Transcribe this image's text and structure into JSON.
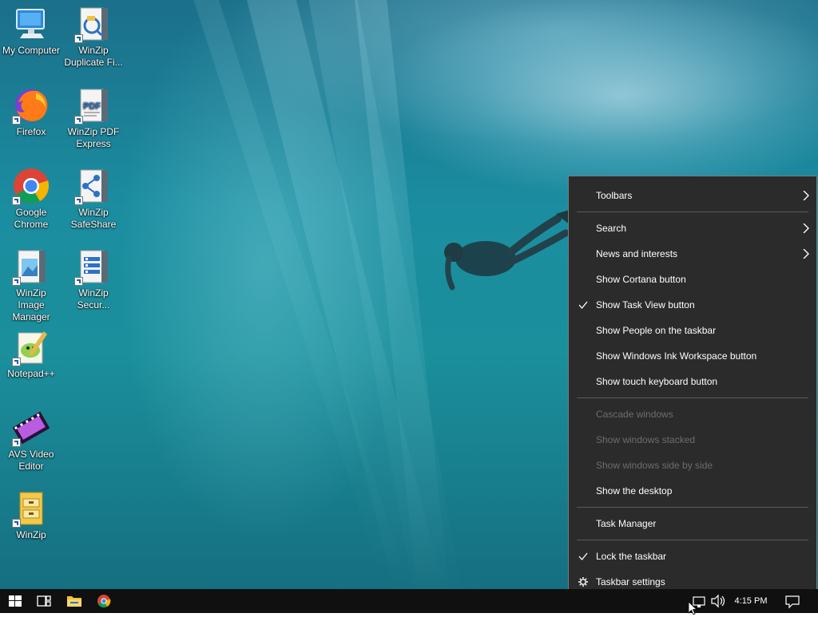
{
  "desktop": {
    "icons": [
      {
        "label": "My Computer",
        "icon": "computer-icon"
      },
      {
        "label": "WinZip Duplicate Fi...",
        "icon": "winzip-duplicate-icon"
      },
      {
        "label": "Firefox",
        "icon": "firefox-icon"
      },
      {
        "label": "WinZip PDF Express",
        "icon": "winzip-pdf-icon"
      },
      {
        "label": "Google Chrome",
        "icon": "chrome-icon"
      },
      {
        "label": "WinZip SafeShare",
        "icon": "winzip-safeshare-icon"
      },
      {
        "label": "WinZip Image Manager",
        "icon": "winzip-image-manager-icon"
      },
      {
        "label": "WinZip Secur...",
        "icon": "winzip-secure-icon"
      },
      {
        "label": "Notepad++",
        "icon": "notepadpp-icon"
      },
      {
        "label": "AVS Video Editor",
        "icon": "avs-video-editor-icon"
      },
      {
        "label": "WinZip",
        "icon": "winzip-icon"
      }
    ]
  },
  "context_menu": {
    "items": [
      {
        "label": "Toolbars",
        "submenu": true,
        "checked": false,
        "disabled": false
      },
      {
        "label": "Search",
        "submenu": true,
        "checked": false,
        "disabled": false
      },
      {
        "label": "News and interests",
        "submenu": true,
        "checked": false,
        "disabled": false
      },
      {
        "label": "Show Cortana button",
        "submenu": false,
        "checked": false,
        "disabled": false
      },
      {
        "label": "Show Task View button",
        "submenu": false,
        "checked": true,
        "disabled": false
      },
      {
        "label": "Show People on the taskbar",
        "submenu": false,
        "checked": false,
        "disabled": false
      },
      {
        "label": "Show Windows Ink Workspace button",
        "submenu": false,
        "checked": false,
        "disabled": false
      },
      {
        "label": "Show touch keyboard button",
        "submenu": false,
        "checked": false,
        "disabled": false
      },
      {
        "label": "Cascade windows",
        "submenu": false,
        "checked": false,
        "disabled": true
      },
      {
        "label": "Show windows stacked",
        "submenu": false,
        "checked": false,
        "disabled": true
      },
      {
        "label": "Show windows side by side",
        "submenu": false,
        "checked": false,
        "disabled": true
      },
      {
        "label": "Show the desktop",
        "submenu": false,
        "checked": false,
        "disabled": false
      },
      {
        "label": "Task Manager",
        "submenu": false,
        "checked": false,
        "disabled": false
      },
      {
        "label": "Lock the taskbar",
        "submenu": false,
        "checked": true,
        "disabled": false
      },
      {
        "label": "Taskbar settings",
        "submenu": false,
        "checked": false,
        "disabled": false,
        "icon": "gear-icon"
      }
    ]
  },
  "taskbar": {
    "buttons": [
      "windows-start-icon",
      "task-view-icon",
      "file-explorer-icon",
      "chrome-icon"
    ],
    "tray": {
      "time": "4:15 PM",
      "icons": [
        "network-icon",
        "volume-icon",
        "notification-icon"
      ]
    }
  },
  "colors": {
    "menu_bg": "#2b2b2b",
    "menu_text": "#ffffff",
    "menu_disabled_text": "#6d6d6d",
    "taskbar_bg": "#101010"
  }
}
